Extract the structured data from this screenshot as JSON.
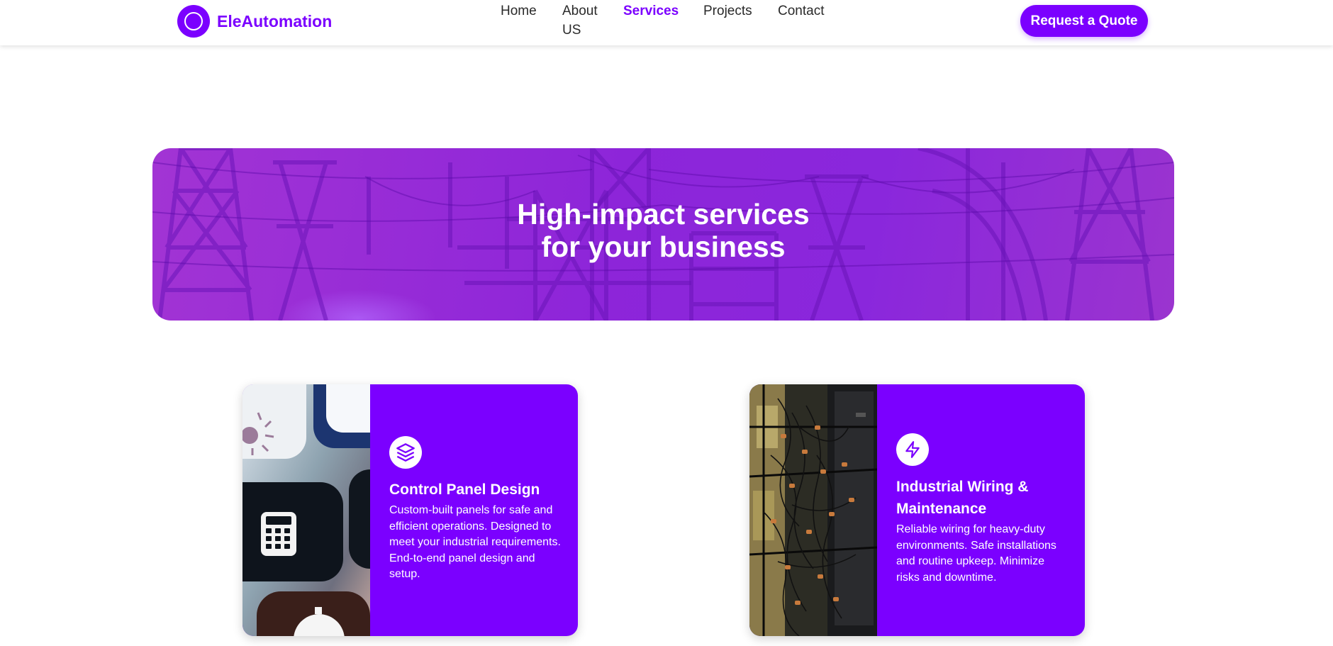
{
  "brand": {
    "name": "EleAutomation"
  },
  "nav": {
    "items": [
      {
        "label": "Home",
        "active": false
      },
      {
        "label": "About US",
        "active": false
      },
      {
        "label": "Services",
        "active": true
      },
      {
        "label": "Projects",
        "active": false
      },
      {
        "label": "Contact",
        "active": false
      }
    ]
  },
  "header": {
    "cta_label": "Request a Quote"
  },
  "hero": {
    "title_line1": "High-impact services",
    "title_line2": "for your business"
  },
  "services": [
    {
      "icon": "layers-icon",
      "title": "Control Panel Design",
      "description": "Custom-built panels for safe and efficient operations. Designed to meet your industrial requirements. End-to-end panel design and setup."
    },
    {
      "icon": "lightning-bolt-icon",
      "title": "Industrial Wiring & Maintenance",
      "description": "Reliable wiring for heavy-duty environments. Safe installations and routine upkeep. Minimize risks and downtime."
    }
  ],
  "colors": {
    "primary": "#7b00ff",
    "hero_overlay": "#9b2fd6"
  }
}
